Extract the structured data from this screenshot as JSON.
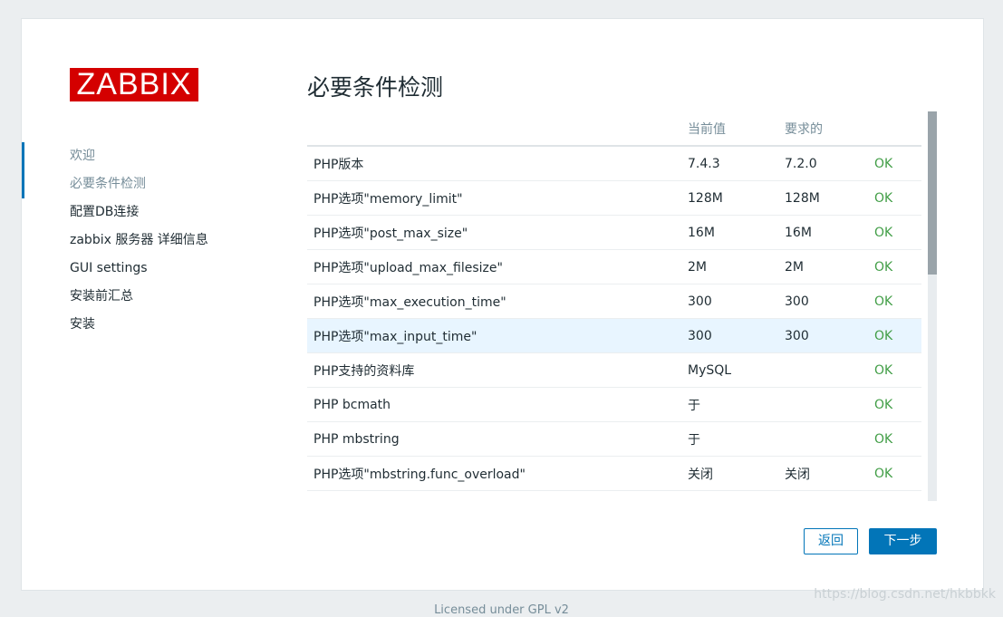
{
  "logo": {
    "text": "ZABBIX",
    "color": "#d40000"
  },
  "nav": {
    "items": [
      {
        "label": "欢迎",
        "state": "done"
      },
      {
        "label": "必要条件检测",
        "state": "active"
      },
      {
        "label": "配置DB连接",
        "state": "pending"
      },
      {
        "label": "zabbix 服务器 详细信息",
        "state": "pending"
      },
      {
        "label": "GUI settings",
        "state": "pending"
      },
      {
        "label": "安装前汇总",
        "state": "pending"
      },
      {
        "label": "安装",
        "state": "pending"
      }
    ]
  },
  "page": {
    "title": "必要条件检测"
  },
  "table": {
    "headers": [
      "",
      "当前值",
      "要求的",
      ""
    ],
    "rows": [
      {
        "name": "PHP版本",
        "current": "7.4.3",
        "required": "7.2.0",
        "status": "OK"
      },
      {
        "name": "PHP选项\"memory_limit\"",
        "current": "128M",
        "required": "128M",
        "status": "OK"
      },
      {
        "name": "PHP选项\"post_max_size\"",
        "current": "16M",
        "required": "16M",
        "status": "OK"
      },
      {
        "name": "PHP选项\"upload_max_filesize\"",
        "current": "2M",
        "required": "2M",
        "status": "OK"
      },
      {
        "name": "PHP选项\"max_execution_time\"",
        "current": "300",
        "required": "300",
        "status": "OK"
      },
      {
        "name": "PHP选项\"max_input_time\"",
        "current": "300",
        "required": "300",
        "status": "OK",
        "highlighted": true
      },
      {
        "name": "PHP支持的资料库",
        "current": "MySQL",
        "required": "",
        "status": "OK"
      },
      {
        "name": "PHP bcmath",
        "current": "于",
        "required": "",
        "status": "OK"
      },
      {
        "name": "PHP mbstring",
        "current": "于",
        "required": "",
        "status": "OK"
      },
      {
        "name": "PHP选项\"mbstring.func_overload\"",
        "current": "关闭",
        "required": "关闭",
        "status": "OK"
      }
    ],
    "status_color": "#429e47"
  },
  "buttons": {
    "back": "返回",
    "next": "下一步"
  },
  "footer": {
    "text": "Licensed under GPL v2"
  },
  "watermark": {
    "text": "https://blog.csdn.net/hkbbkk"
  },
  "colors": {
    "accent": "#0275b8",
    "highlight_row": "#e8f5ff"
  }
}
